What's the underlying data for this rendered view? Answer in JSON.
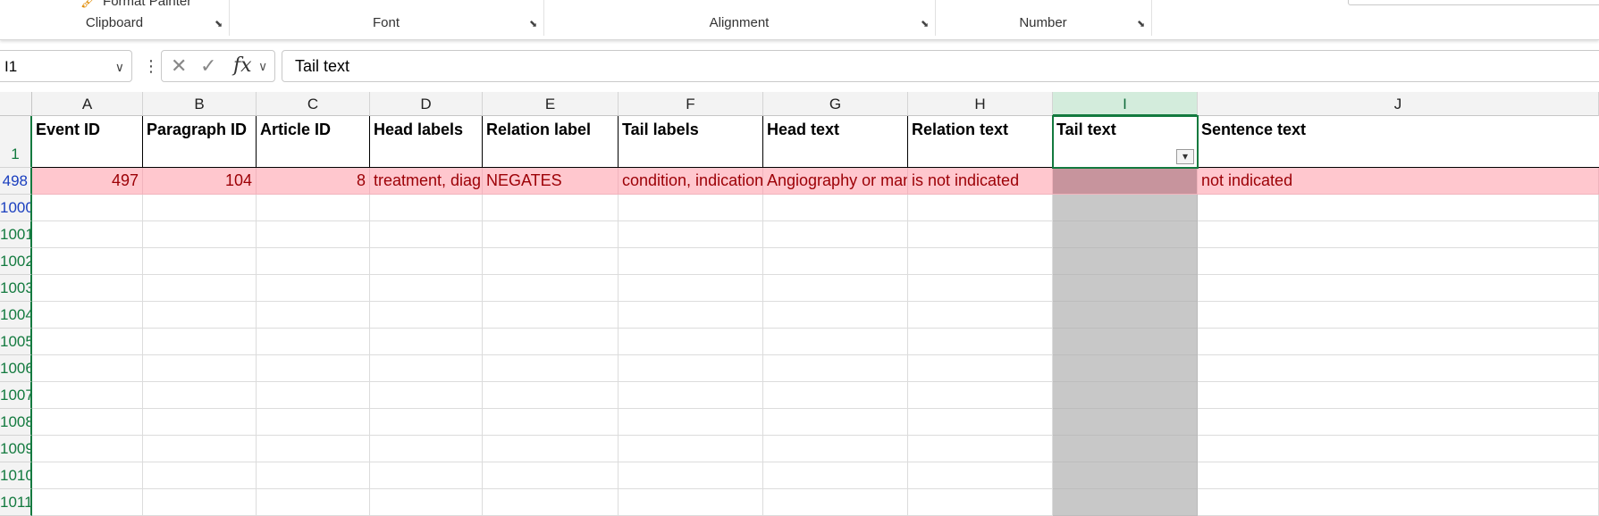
{
  "ribbon": {
    "format_painter_label": "Format Painter",
    "groups": [
      {
        "name": "Clipboard"
      },
      {
        "name": "Font"
      },
      {
        "name": "Alignment"
      },
      {
        "name": "Number"
      }
    ],
    "launcher_glyph": "⬊"
  },
  "formula_bar": {
    "name_box": "I1",
    "formula": "Tail text",
    "cancel_glyph": "✕",
    "enter_glyph": "✓",
    "fx_label": "fx"
  },
  "columns": [
    "A",
    "B",
    "C",
    "D",
    "E",
    "F",
    "G",
    "H",
    "I",
    "J"
  ],
  "selected_column": "I",
  "header_row": {
    "row_number": "1",
    "cells": [
      "Event ID",
      "Paragraph ID",
      "Article ID",
      "Head labels",
      "Relation label",
      "Tail labels",
      "Head text",
      "Relation text",
      "Tail text",
      "Sentence text"
    ]
  },
  "data_row": {
    "row_number": "498",
    "cells": [
      "497",
      "104",
      "8",
      "treatment, diagnosis",
      "NEGATES",
      "condition, indication",
      "Angiography or management",
      "is not indicated",
      "",
      "not indicated"
    ]
  },
  "empty_rows": [
    "1000",
    "1001",
    "1002",
    "1003",
    "1004",
    "1005",
    "1006",
    "1007",
    "1008",
    "1009",
    "1010",
    "1011"
  ],
  "colors": {
    "accent_green": "#137a3f",
    "bad_fill": "#ffc7ce",
    "bad_text": "#9c0006",
    "selection_gray": "#c8c8c8"
  }
}
